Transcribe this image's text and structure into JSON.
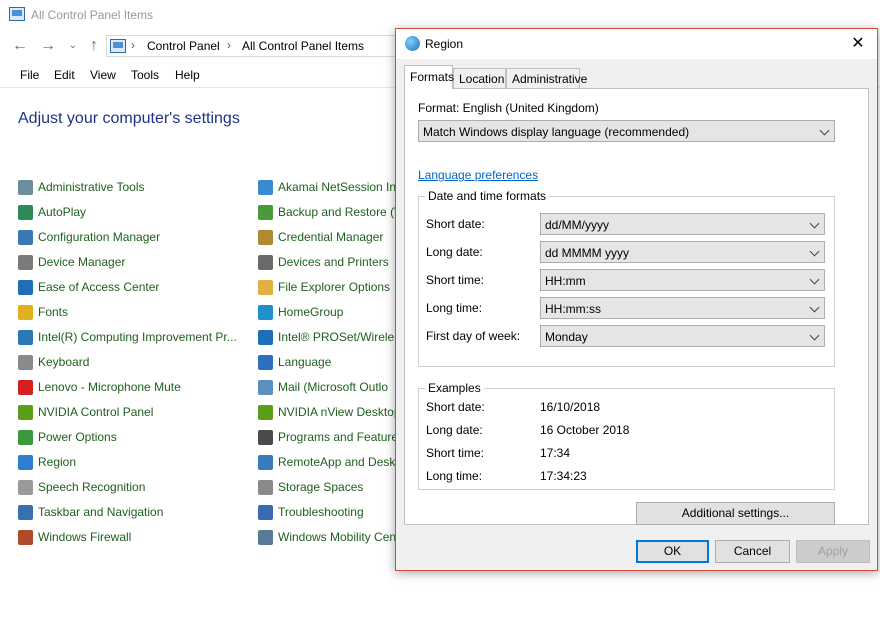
{
  "control_panel": {
    "title": "All Control Panel Items",
    "breadcrumb": [
      "Control Panel",
      "All Control Panel Items"
    ],
    "menu": [
      "File",
      "Edit",
      "View",
      "Tools",
      "Help"
    ],
    "heading": "Adjust your computer's settings",
    "column1": [
      {
        "label": "Administrative Tools",
        "icon": "admin-tools-icon",
        "color": "#6b8e9b"
      },
      {
        "label": "AutoPlay",
        "icon": "autoplay-icon",
        "color": "#2e8b57"
      },
      {
        "label": "Configuration Manager",
        "icon": "config-manager-icon",
        "color": "#3a78b5"
      },
      {
        "label": "Device Manager",
        "icon": "device-manager-icon",
        "color": "#7a7a7a"
      },
      {
        "label": "Ease of Access Center",
        "icon": "ease-of-access-icon",
        "color": "#1f6fb8"
      },
      {
        "label": "Fonts",
        "icon": "fonts-icon",
        "color": "#e0b020"
      },
      {
        "label": "Intel(R) Computing Improvement Pr...",
        "icon": "intel-icon",
        "color": "#2a7ab8"
      },
      {
        "label": "Keyboard",
        "icon": "keyboard-icon",
        "color": "#8a8a8a"
      },
      {
        "label": "Lenovo - Microphone Mute",
        "icon": "lenovo-icon",
        "color": "#d42020"
      },
      {
        "label": "NVIDIA Control Panel",
        "icon": "nvidia-icon",
        "color": "#5a9e1a"
      },
      {
        "label": "Power Options",
        "icon": "power-options-icon",
        "color": "#3a9a3a"
      },
      {
        "label": "Region",
        "icon": "region-icon",
        "color": "#2f7fd0"
      },
      {
        "label": "Speech Recognition",
        "icon": "speech-recognition-icon",
        "color": "#9a9a9a"
      },
      {
        "label": "Taskbar and Navigation",
        "icon": "taskbar-icon",
        "color": "#3a6fb0"
      },
      {
        "label": "Windows Firewall",
        "icon": "firewall-icon",
        "color": "#b04a2a"
      }
    ],
    "column2": [
      {
        "label": "Akamai NetSession Int",
        "icon": "akamai-icon",
        "color": "#3a8ad0"
      },
      {
        "label": "Backup and Restore (W",
        "icon": "backup-restore-icon",
        "color": "#4a9a3a"
      },
      {
        "label": "Credential Manager",
        "icon": "credential-manager-icon",
        "color": "#b08a30"
      },
      {
        "label": "Devices and Printers",
        "icon": "devices-printers-icon",
        "color": "#6a6a6a"
      },
      {
        "label": "File Explorer Options",
        "icon": "file-explorer-icon",
        "color": "#e0b040"
      },
      {
        "label": "HomeGroup",
        "icon": "homegroup-icon",
        "color": "#1f8fd0"
      },
      {
        "label": "Intel® PROSet/Wireles",
        "icon": "intel-proset-icon",
        "color": "#1f6fb8"
      },
      {
        "label": "Language",
        "icon": "language-icon",
        "color": "#2f6fc0"
      },
      {
        "label": "Mail (Microsoft Outlo",
        "icon": "mail-icon",
        "color": "#5a8fc0"
      },
      {
        "label": "NVIDIA nView Desktop",
        "icon": "nview-icon",
        "color": "#5a9e1a"
      },
      {
        "label": "Programs and Feature",
        "icon": "programs-icon",
        "color": "#4a4a4a"
      },
      {
        "label": "RemoteApp and Deskt",
        "icon": "remoteapp-icon",
        "color": "#3a7ac0"
      },
      {
        "label": "Storage Spaces",
        "icon": "storage-spaces-icon",
        "color": "#8a8a8a"
      },
      {
        "label": "Troubleshooting",
        "icon": "troubleshooting-icon",
        "color": "#3a6ab0"
      },
      {
        "label": "Windows Mobility Cen",
        "icon": "mobility-icon",
        "color": "#5a7a9a"
      }
    ]
  },
  "region_dialog": {
    "title": "Region",
    "close_glyph": "✕",
    "tabs": [
      "Formats",
      "Location",
      "Administrative"
    ],
    "format_label": "Format: English (United Kingdom)",
    "format_value": "Match Windows display language (recommended)",
    "language_link": "Language preferences",
    "datetime_group": {
      "legend": "Date and time formats",
      "rows": [
        {
          "label": "Short date:",
          "value": "dd/MM/yyyy"
        },
        {
          "label": "Long date:",
          "value": "dd MMMM yyyy"
        },
        {
          "label": "Short time:",
          "value": "HH:mm"
        },
        {
          "label": "Long time:",
          "value": "HH:mm:ss"
        },
        {
          "label": "First day of week:",
          "value": "Monday"
        }
      ]
    },
    "examples_group": {
      "legend": "Examples",
      "rows": [
        {
          "label": "Short date:",
          "value": "16/10/2018"
        },
        {
          "label": "Long date:",
          "value": "16 October 2018"
        },
        {
          "label": "Short time:",
          "value": "17:34"
        },
        {
          "label": "Long time:",
          "value": "17:34:23"
        }
      ]
    },
    "additional_button": "Additional settings...",
    "ok_button": "OK",
    "cancel_button": "Cancel",
    "apply_button": "Apply"
  }
}
